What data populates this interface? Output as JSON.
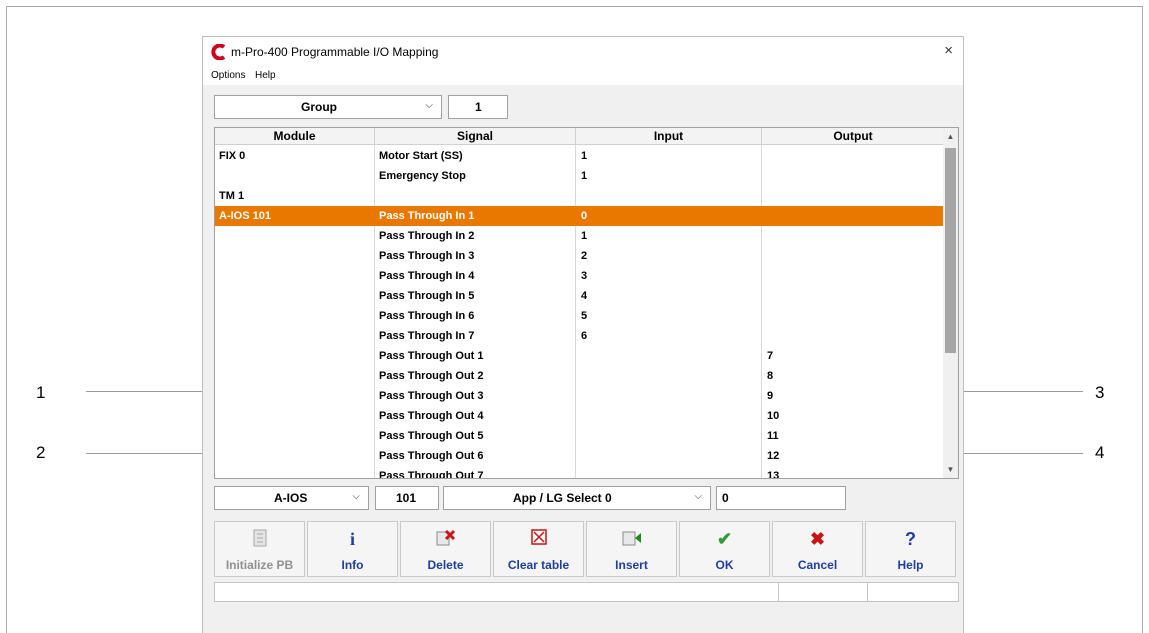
{
  "window": {
    "title": "m-Pro-400  Programmable I/O Mapping",
    "close_glyph": "×",
    "logo_letter": "C"
  },
  "menu": [
    "Options",
    "Help"
  ],
  "group_filter": {
    "label": "Group",
    "value": "1"
  },
  "table": {
    "columns": [
      "Module",
      "Signal",
      "Input",
      "Output"
    ],
    "rows": [
      {
        "module": "FIX  0",
        "signal": "Motor Start (SS)",
        "input": "1",
        "output": ""
      },
      {
        "module": "",
        "signal": "Emergency Stop",
        "input": "1",
        "output": ""
      },
      {
        "module": "TM  1",
        "signal": "",
        "input": "",
        "output": ""
      },
      {
        "module": "A-IOS 101",
        "signal": "Pass Through In 1",
        "input": "0",
        "output": "",
        "selected": true
      },
      {
        "module": "",
        "signal": "Pass Through In 2",
        "input": "1",
        "output": ""
      },
      {
        "module": "",
        "signal": "Pass Through In 3",
        "input": "2",
        "output": ""
      },
      {
        "module": "",
        "signal": "Pass Through In 4",
        "input": "3",
        "output": ""
      },
      {
        "module": "",
        "signal": "Pass Through In 5",
        "input": "4",
        "output": ""
      },
      {
        "module": "",
        "signal": "Pass Through In 6",
        "input": "5",
        "output": ""
      },
      {
        "module": "",
        "signal": "Pass Through In 7",
        "input": "6",
        "output": ""
      },
      {
        "module": "",
        "signal": "Pass Through Out 1",
        "input": "",
        "output": "7"
      },
      {
        "module": "",
        "signal": "Pass Through Out 2",
        "input": "",
        "output": "8"
      },
      {
        "module": "",
        "signal": "Pass Through Out 3",
        "input": "",
        "output": "9"
      },
      {
        "module": "",
        "signal": "Pass Through Out 4",
        "input": "",
        "output": "10"
      },
      {
        "module": "",
        "signal": "Pass Through Out 5",
        "input": "",
        "output": "11"
      },
      {
        "module": "",
        "signal": "Pass Through Out 6",
        "input": "",
        "output": "12"
      },
      {
        "module": "",
        "signal": "Pass Through Out 7",
        "input": "",
        "output": "13"
      }
    ]
  },
  "editor": {
    "module_type": "A-IOS",
    "module_number": "101",
    "signal_select": "App / LG Select 0",
    "io_value": "0"
  },
  "buttons": [
    {
      "label": "Initialize PB",
      "icon": "initialize-icon",
      "enabled": false
    },
    {
      "label": "Info",
      "icon": "info-icon",
      "enabled": true
    },
    {
      "label": "Delete",
      "icon": "delete-icon",
      "enabled": true
    },
    {
      "label": "Clear table",
      "icon": "clear-table-icon",
      "enabled": true
    },
    {
      "label": "Insert",
      "icon": "insert-icon",
      "enabled": true
    },
    {
      "label": "OK",
      "icon": "checkmark-icon",
      "enabled": true
    },
    {
      "label": "Cancel",
      "icon": "cancel-icon",
      "enabled": true
    },
    {
      "label": "Help",
      "icon": "help-icon",
      "enabled": true
    }
  ],
  "callouts": [
    "1",
    "2",
    "3",
    "4"
  ],
  "colors": {
    "selection": "#e87800",
    "logo": "#d0021b",
    "button_text": "#1f3e9e",
    "ok_check": "#2e9e2e",
    "cancel_x": "#cc1111",
    "disabled": "#909090"
  }
}
